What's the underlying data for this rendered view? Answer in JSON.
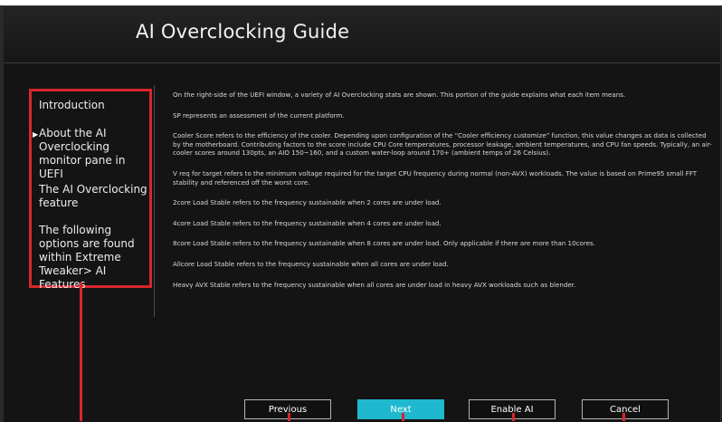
{
  "window": {
    "title": "AI Overclocking Guide"
  },
  "nav": {
    "items": [
      {
        "label": "Introduction",
        "selected": false
      },
      {
        "label": "About the AI Overclocking monitor pane in UEFI",
        "selected": true
      },
      {
        "label": "The AI Overclocking feature",
        "selected": false
      },
      {
        "label": "The following options are found within Extreme Tweaker> AI Features",
        "selected": false
      }
    ],
    "bullet": "▶"
  },
  "content": {
    "paragraphs": [
      "On the right-side of the UEFI window, a variety of AI Overclocking stats are shown. This portion of the guide explains what each item means.",
      "SP represents an assessment of the current platform.",
      "Cooler Score refers to the efficiency of the cooler. Depending upon configuration of the “Cooler efficiency customize” function, this value changes as data is collected by the motherboard. Contributing factors to the score include CPU Core temperatures, processor leakage, ambient temperatures, and CPU fan speeds. Typically, an air-cooler scores around 130pts, an AIO 150~160, and a custom water-loop around 170+ (ambient temps of 26 Celsius).",
      "V req for target refers to the minimum voltage required for the target CPU frequency during normal (non-AVX) workloads. The value is based on Prime95 small FFT stability and referenced off the worst core.",
      "2core Load Stable refers to the frequency sustainable when 2 cores are under load.",
      "4core Load Stable refers to the frequency sustainable when 4 cores are under load.",
      "8core Load Stable refers to the frequency sustainable when 8 cores are under load. Only applicable if there are more than 10cores.",
      "Allcore Load Stable refers to the frequency sustainable when all cores are under load.",
      "Heavy AVX Stable refers to the frequency sustainable when all cores are under load in heavy AVX workloads such as blender."
    ]
  },
  "buttons": {
    "previous": "Previous",
    "next": "Next",
    "enable_ai": "Enable AI",
    "cancel": "Cancel"
  },
  "colors": {
    "callout": "#d8262c",
    "accent": "#1fb8cf",
    "background": "#141414"
  }
}
